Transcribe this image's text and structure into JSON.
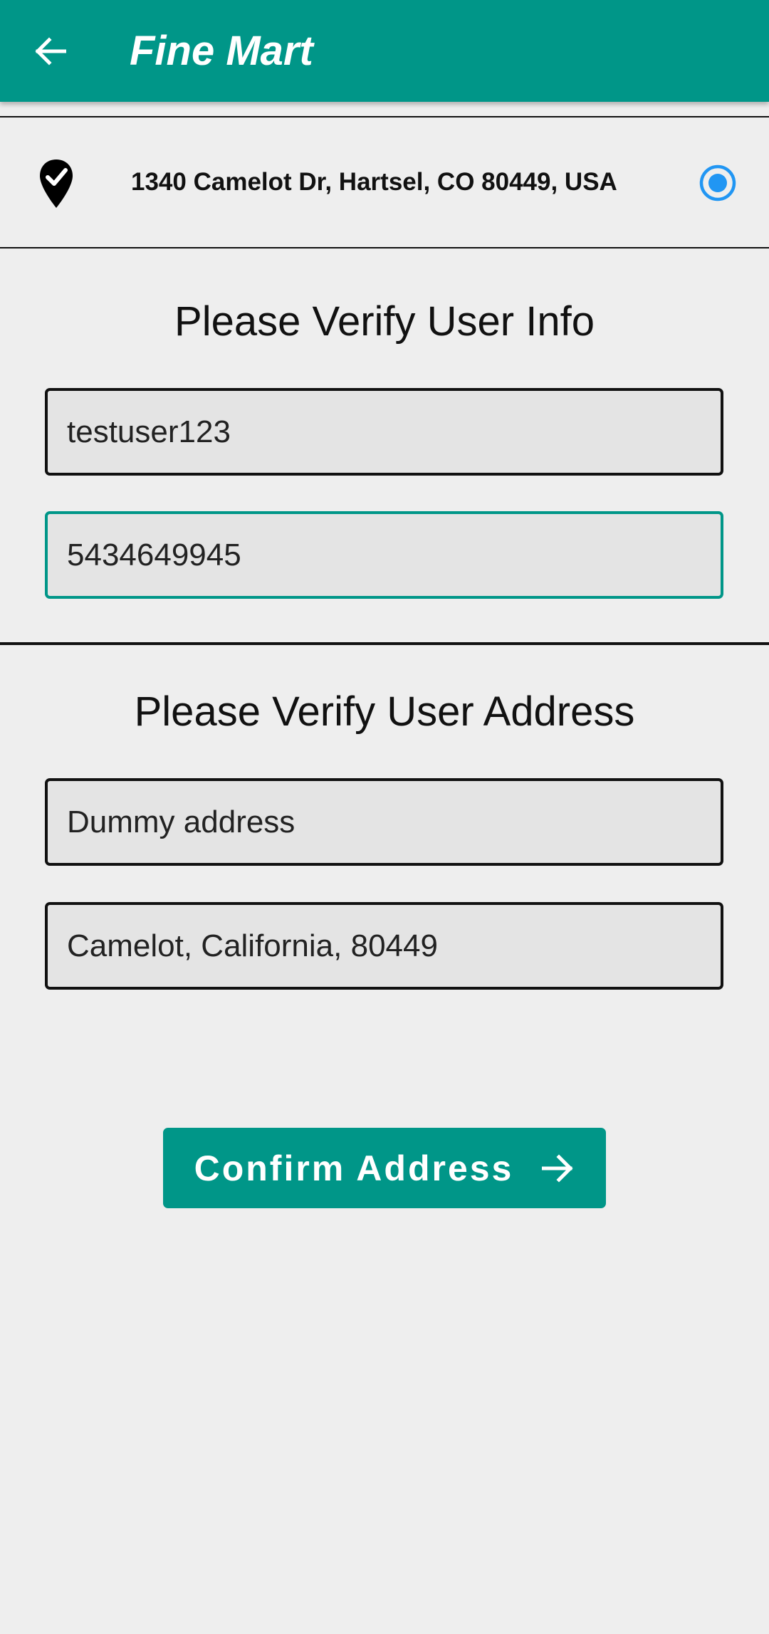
{
  "app_bar": {
    "title": "Fine Mart",
    "back_icon": "arrow-left-icon",
    "background": "#009688"
  },
  "address_option": {
    "text": "1340 Camelot Dr, Hartsel, CO 80449, USA",
    "icon": "location-check-icon",
    "selected": true,
    "radio_color": "#2196f3"
  },
  "user_info": {
    "title": "Please Verify User Info",
    "username": "testuser123",
    "phone": "5434649945"
  },
  "user_address": {
    "title": "Please Verify User Address",
    "address_line": "Dummy address",
    "city_state_zip": "Camelot, California, 80449"
  },
  "confirm": {
    "label": "Confirm Address",
    "icon": "arrow-right-icon"
  }
}
